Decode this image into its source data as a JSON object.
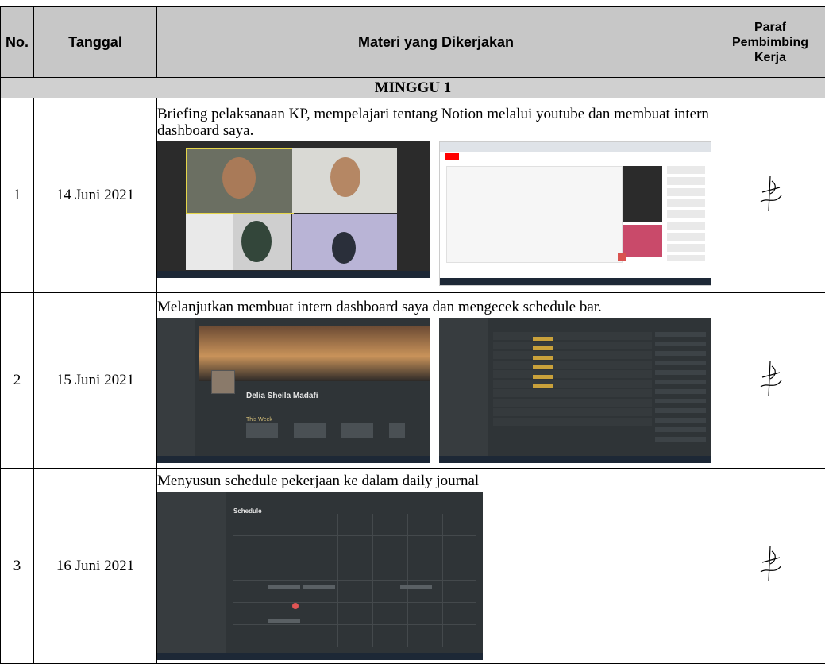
{
  "headers": {
    "no": "No.",
    "date": "Tanggal",
    "material": "Materi yang Dikerjakan",
    "paraf_line1": "Paraf",
    "paraf_line2": "Pembimbing",
    "paraf_line3": "Kerja"
  },
  "week_label": "MINGGU 1",
  "rows": [
    {
      "no": "1",
      "date": "14 Juni 2021",
      "description": "Briefing pelaksanaan KP, mempelajari tentang Notion melalui youtube dan membuat intern dashboard saya."
    },
    {
      "no": "2",
      "date": "15 Juni 2021",
      "description": "Melanjutkan membuat intern dashboard saya dan mengecek schedule bar.",
      "shot_title": "Delia Sheila Madafi",
      "shot_subtitle": "This Week"
    },
    {
      "no": "3",
      "date": "16 Juni 2021",
      "description": "Menyusun schedule pekerjaan ke dalam daily journal",
      "shot_title": "Schedule"
    }
  ],
  "shot_icons": [
    "video-call-screenshot",
    "youtube-screenshot",
    "notion-dashboard-screenshot",
    "notion-table-screenshot",
    "notion-calendar-screenshot"
  ],
  "signature_icon": "signature-icon"
}
